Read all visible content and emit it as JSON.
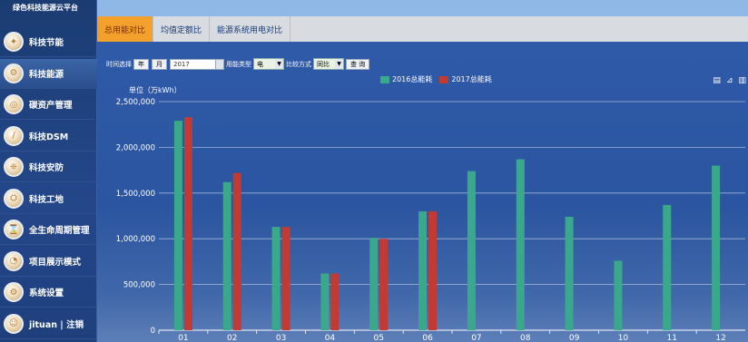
{
  "sidebar": {
    "brand": "绿色科技能源云平台",
    "items": [
      {
        "label": "科技节能",
        "icon": "energy-saving-icon"
      },
      {
        "label": "科技能源",
        "icon": "energy-icon",
        "active": true
      },
      {
        "label": "碳资产管理",
        "icon": "carbon-asset-icon"
      },
      {
        "label": "科技DSM",
        "icon": "dsm-icon"
      },
      {
        "label": "科技安防",
        "icon": "security-icon"
      },
      {
        "label": "科技工地",
        "icon": "construction-icon"
      },
      {
        "label": "全生命周期管理",
        "icon": "lifecycle-icon"
      },
      {
        "label": "项目展示模式",
        "icon": "project-display-icon"
      },
      {
        "label": "系统设置",
        "icon": "settings-icon"
      },
      {
        "label": "jituan | 注销",
        "icon": "user-avatar-icon"
      }
    ]
  },
  "tabs": [
    {
      "label": "总用能对比",
      "active": true
    },
    {
      "label": "均值定额比"
    },
    {
      "label": "能源系统用电对比"
    }
  ],
  "filter": {
    "time_label": "时间选择",
    "year_btn": "年",
    "month_btn": "月",
    "date_value": "2017",
    "energy_type_label": "用能类型",
    "energy_type_value": "电",
    "compare_label": "比较方式",
    "compare_value": "同比",
    "query_btn": "查 询"
  },
  "toolbar_icons": [
    "doc-icon",
    "chart-switch-icon",
    "bar-icon"
  ],
  "chart_data": {
    "type": "bar",
    "ylabel": "单位（万kWh）",
    "categories": [
      "01",
      "02",
      "03",
      "04",
      "05",
      "06",
      "07",
      "08",
      "09",
      "10",
      "11",
      "12"
    ],
    "series": [
      {
        "name": "2016总能耗",
        "color": "#3aa88a",
        "values": [
          2290000,
          1620000,
          1130000,
          620000,
          1010000,
          1300000,
          1740000,
          1870000,
          1240000,
          760000,
          1370000,
          1800000
        ]
      },
      {
        "name": "2017总能耗",
        "color": "#c23a32",
        "values": [
          2330000,
          1720000,
          1130000,
          620000,
          1000000,
          1300000,
          null,
          null,
          null,
          null,
          null,
          null
        ]
      }
    ],
    "ylim": [
      0,
      2500000
    ],
    "yticks": [
      "0",
      "500,000",
      "1,000,000",
      "1,500,000",
      "2,000,000",
      "2,500,000"
    ],
    "legend_position": "top-center",
    "grid": true
  }
}
